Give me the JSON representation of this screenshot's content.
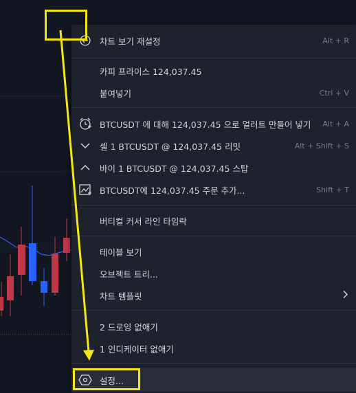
{
  "menu": {
    "reset_chart": {
      "label": "차트 보기 재설정",
      "shortcut": "Alt + R",
      "icon": "reset-icon"
    },
    "copy_price": {
      "label": "카피 프라이스 124,037.45"
    },
    "paste": {
      "label": "붙여넣기",
      "shortcut": "Ctrl + V"
    },
    "add_alert": {
      "label": "BTCUSDT 에 대해 124,037.45 으로 얼러트 만들어 넣기",
      "shortcut": "Alt + A",
      "icon": "alarm-clock-icon"
    },
    "sell_limit": {
      "label": "셀 1 BTCUSDT @ 124,037.45 리밋",
      "shortcut": "Alt + Shift + S",
      "icon": "chevron-down-icon"
    },
    "buy_stop": {
      "label": "바이 1 BTCUSDT @ 124,037.45 스탑",
      "icon": "chevron-up-icon"
    },
    "add_order": {
      "label": "BTCUSDT에 124,037.45 주문 추가...",
      "shortcut": "Shift + T",
      "icon": "chart-order-icon"
    },
    "vertical_cursor": {
      "label": "버티컬 커서 라인 타임락"
    },
    "table_view": {
      "label": "테이블 보기"
    },
    "object_tree": {
      "label": "오브젝트 트리..."
    },
    "chart_template": {
      "label": "차트 템플릿",
      "icon": "chevron-right-icon"
    },
    "remove_drawings": {
      "label": "2 드로잉 없애기"
    },
    "remove_indicators": {
      "label": "1 인디케이터 없애기"
    },
    "settings": {
      "label": "설정...",
      "icon": "gear-hex-icon"
    }
  },
  "colors": {
    "background": "#131722",
    "menu_bg": "#1e222d",
    "text": "#d1d4dc",
    "muted": "#787b86",
    "annotation": "#f5e616",
    "candle_up": "#2962ff",
    "candle_down": "#c0394b"
  }
}
